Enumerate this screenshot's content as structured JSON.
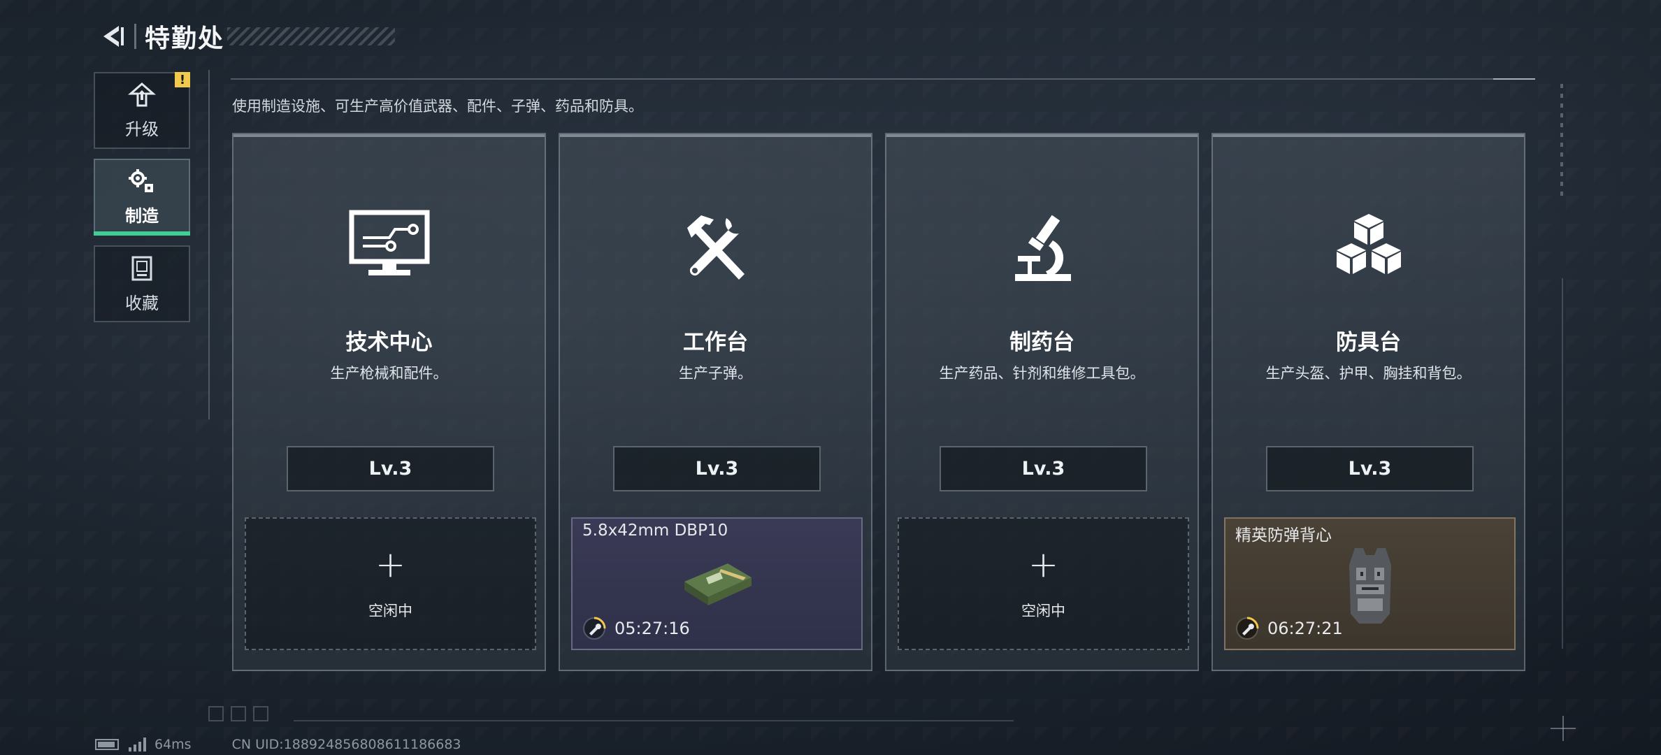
{
  "header": {
    "title": "特勤处"
  },
  "sidebar": {
    "items": [
      {
        "label": "升级",
        "icon": "upgrade-icon",
        "badge": "!"
      },
      {
        "label": "制造",
        "icon": "gears-icon",
        "active": true
      },
      {
        "label": "收藏",
        "icon": "collection-icon"
      }
    ]
  },
  "main": {
    "description": "使用制造设施、可生产高价值武器、配件、子弹、药品和防具。",
    "stations": [
      {
        "name": "技术中心",
        "desc": "生产枪械和配件。",
        "level": "Lv.3",
        "icon": "monitor-circuit-icon",
        "slot": {
          "state": "idle",
          "plus": "+",
          "label": "空闲中"
        }
      },
      {
        "name": "工作台",
        "desc": "生产子弹。",
        "level": "Lv.3",
        "icon": "hammer-wrench-icon",
        "slot": {
          "state": "busy",
          "item": "5.8x42mm DBP10",
          "timer": "05:27:16",
          "item_icon": "ammo-box-icon"
        }
      },
      {
        "name": "制药台",
        "desc": "生产药品、针剂和维修工具包。",
        "level": "Lv.3",
        "icon": "microscope-icon",
        "slot": {
          "state": "idle",
          "plus": "+",
          "label": "空闲中"
        }
      },
      {
        "name": "防具台",
        "desc": "生产头盔、护甲、胸挂和背包。",
        "level": "Lv.3",
        "icon": "cubes-icon",
        "slot": {
          "state": "busy",
          "item": "精英防弹背心",
          "timer": "06:27:21",
          "item_icon": "body-armor-icon"
        }
      }
    ]
  },
  "status_bar": {
    "ping": "64ms",
    "uid": "CN UID:1889248568086111866​83"
  },
  "colors": {
    "accent": "#3fcf94",
    "warning": "#f2c94c"
  }
}
